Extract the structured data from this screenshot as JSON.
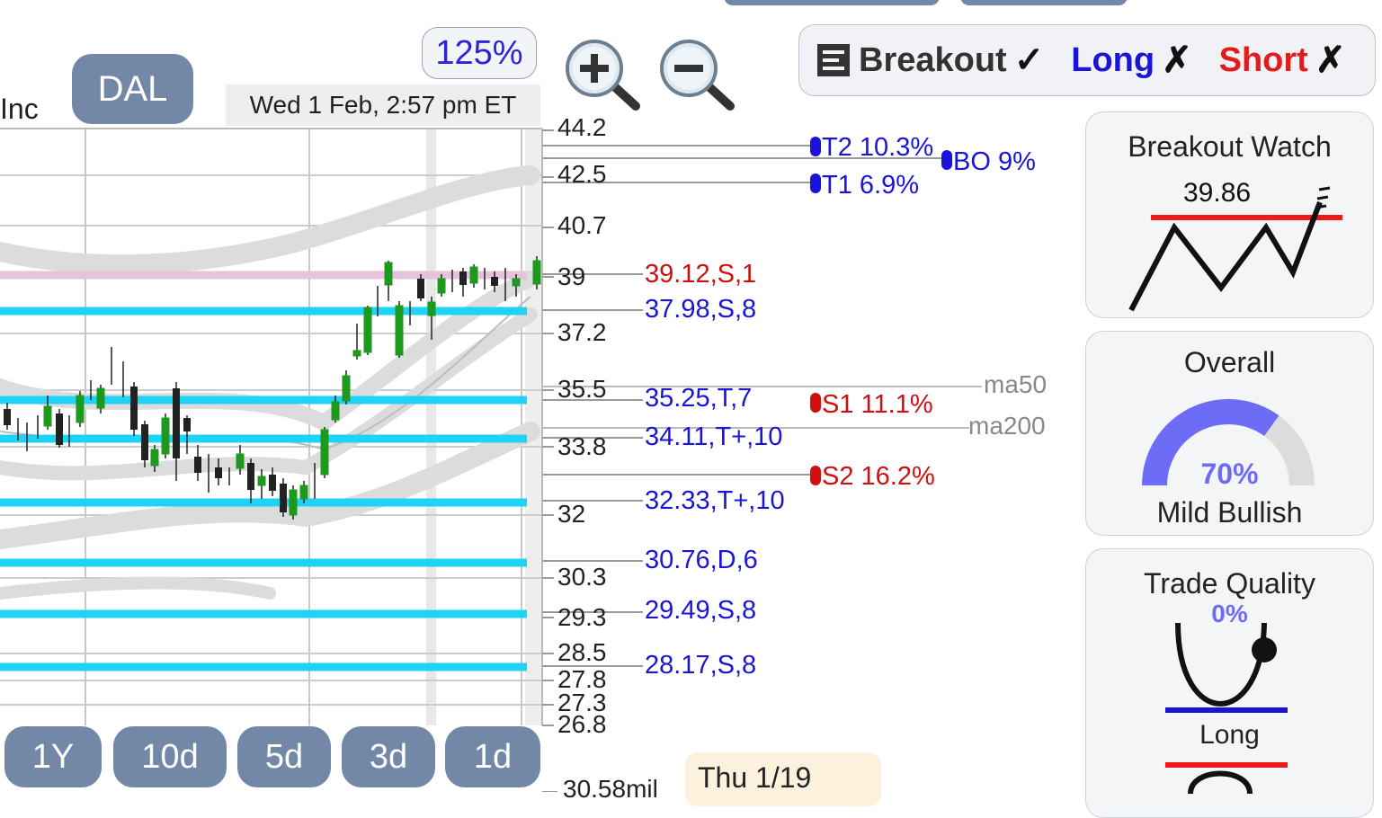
{
  "company_fragment": "Inc",
  "ticker": "DAL",
  "zoom_level": "125%",
  "timestamp": "Wed 1 Feb, 2:57 pm ET",
  "signals": {
    "breakout": {
      "label": "Breakout",
      "mark": "✓",
      "color": "#333333"
    },
    "long": {
      "label": "Long",
      "mark": "✗",
      "color": "#1a14d8"
    },
    "short": {
      "label": "Short",
      "mark": "✗",
      "color": "#e01c1c"
    }
  },
  "price_axis": [
    "44.2",
    "42.5",
    "40.7",
    "39",
    "37.2",
    "35.5",
    "33.8",
    "32",
    "30.3",
    "29.3",
    "28.5",
    "27.8",
    "27.3",
    "26.8"
  ],
  "volume_label": "30.58mil",
  "levels": [
    {
      "text": "39.12,S,1",
      "color": "#d01010"
    },
    {
      "text": "37.98,S,8",
      "color": "#1a14d8"
    },
    {
      "text": "35.25,T,7",
      "color": "#1a14d8"
    },
    {
      "text": "34.11,T+,10",
      "color": "#1a14d8"
    },
    {
      "text": "32.33,T+,10",
      "color": "#1a14d8"
    },
    {
      "text": "30.76,D,6",
      "color": "#1a14d8"
    },
    {
      "text": "29.49,S,8",
      "color": "#1a14d8"
    },
    {
      "text": "28.17,S,8",
      "color": "#1a14d8"
    }
  ],
  "targets": {
    "t2": "T2 10.3%",
    "t1": "T1 6.9%",
    "bo": "BO 9%",
    "s1": "S1 11.1%",
    "s2": "S2 16.2%"
  },
  "ma_labels": {
    "ma50": "ma50",
    "ma200": "ma200"
  },
  "breakout_watch": {
    "title": "Breakout Watch",
    "value": "39.86"
  },
  "overall": {
    "title": "Overall",
    "percent": "70%",
    "sentiment": "Mild Bullish",
    "fraction": 0.7
  },
  "trade_quality": {
    "title": "Trade Quality",
    "percent": "0%",
    "direction": "Long"
  },
  "timeframes": [
    "1Y",
    "10d",
    "5d",
    "3d",
    "1d"
  ],
  "date_tip": "Thu 1/19",
  "colors": {
    "button": "#7388a6",
    "level_band": "#1ed3f5",
    "resistance": "#e7c2dc",
    "up_candle": "#1d9a1d",
    "down_candle": "#222222",
    "gauge": "#6d6cf7"
  }
}
